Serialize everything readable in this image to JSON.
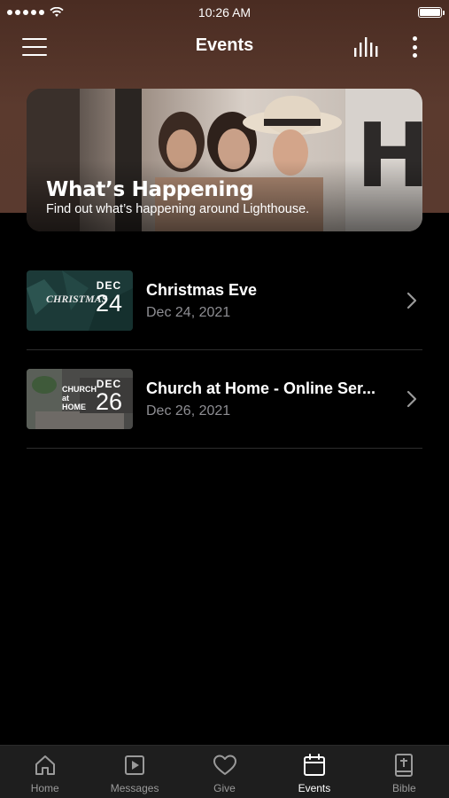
{
  "status_bar": {
    "time": "10:26 AM"
  },
  "nav": {
    "title": "Events"
  },
  "banner": {
    "title": "What’s Happening",
    "subtitle": "Find out what’s happening around Lighthouse."
  },
  "events": [
    {
      "title": "Christmas Eve",
      "date": "Dec 24, 2021",
      "thumb_month": "DEC",
      "thumb_day": "24",
      "thumb_caption": "CHRISTMAS"
    },
    {
      "title": "Church at Home - Online Ser...",
      "date": "Dec 26, 2021",
      "thumb_month": "DEC",
      "thumb_day": "26",
      "thumb_caption": "CHURCH at HOME"
    }
  ],
  "tabs": [
    {
      "label": "Home",
      "icon": "home-icon"
    },
    {
      "label": "Messages",
      "icon": "play-square-icon"
    },
    {
      "label": "Give",
      "icon": "heart-icon"
    },
    {
      "label": "Events",
      "icon": "calendar-icon",
      "active": true
    },
    {
      "label": "Bible",
      "icon": "bible-icon"
    }
  ],
  "colors": {
    "header_bg": "#5a3a2f",
    "tab_bar_bg": "#1e1e1e",
    "muted_text": "#8e8e93"
  }
}
